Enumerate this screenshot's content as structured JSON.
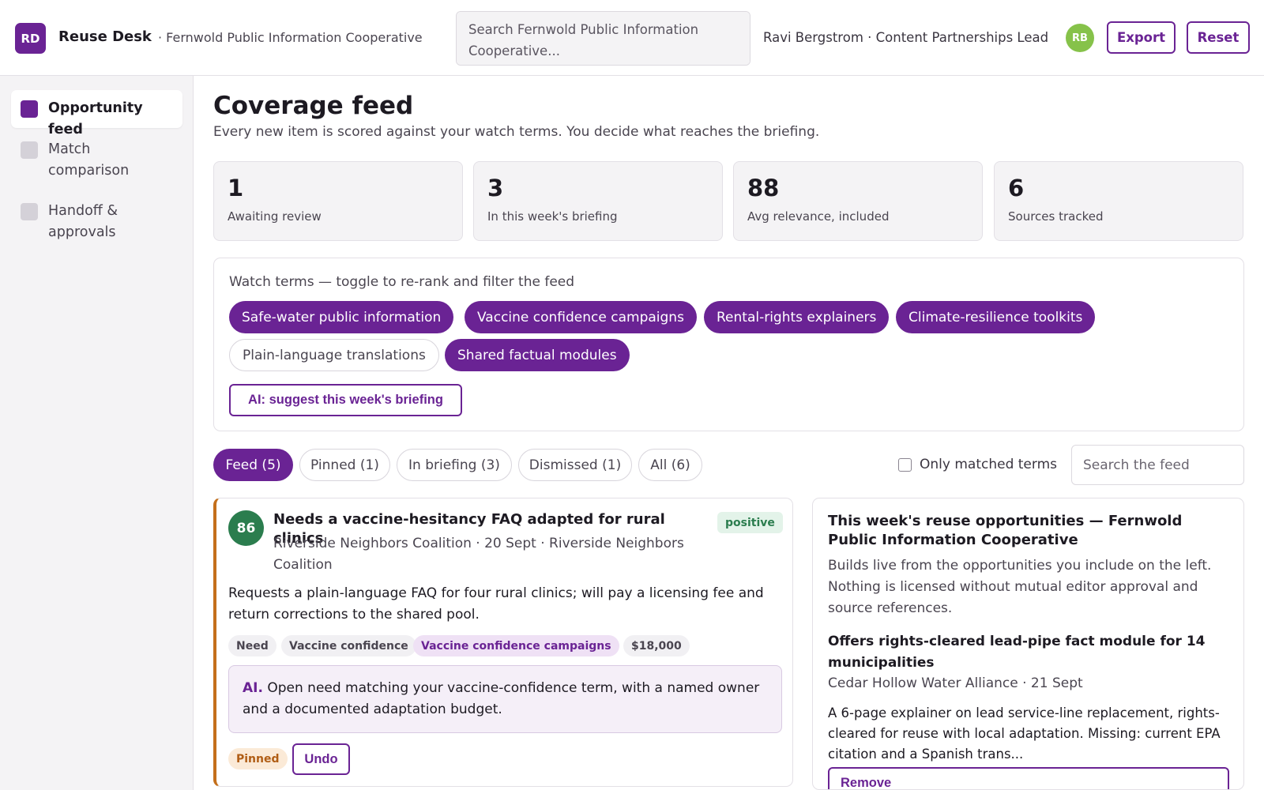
{
  "header": {
    "logo": "RD",
    "app_name": "Reuse Desk",
    "org": "· Fernwold Public Information Cooperative",
    "search_value": "Search Fernwold Public Information Cooperative...",
    "user": "Ravi Bergstrom · Content Partnerships Lead",
    "avatar": "RB",
    "export_label": "Export",
    "reset_label": "Reset"
  },
  "sidebar": {
    "items": [
      {
        "label": "Opportunity feed",
        "active": true
      },
      {
        "label": "Match comparison",
        "active": false
      },
      {
        "label": "Handoff & approvals",
        "active": false
      }
    ]
  },
  "main": {
    "title": "Coverage feed",
    "subtitle": "Every new item is scored against your watch terms. You decide what reaches the briefing."
  },
  "stats": [
    {
      "value": "1",
      "label": "Awaiting review"
    },
    {
      "value": "3",
      "label": "In this week's briefing"
    },
    {
      "value": "88",
      "label": "Avg relevance, included"
    },
    {
      "value": "6",
      "label": "Sources tracked"
    }
  ],
  "watch_terms": {
    "title": "Watch terms — toggle to re-rank and filter the feed",
    "terms": [
      {
        "label": "Safe-water public information",
        "on": true
      },
      {
        "label": "Vaccine confidence campaigns",
        "on": true
      },
      {
        "label": "Rental-rights explainers",
        "on": true
      },
      {
        "label": "Climate-resilience toolkits",
        "on": true
      },
      {
        "label": "Plain-language translations",
        "on": false
      },
      {
        "label": "Shared factual modules",
        "on": true
      }
    ],
    "ai_button": "AI: suggest this week's briefing"
  },
  "tabs": [
    {
      "label": "Feed (5)",
      "active": true
    },
    {
      "label": "Pinned (1)",
      "active": false
    },
    {
      "label": "In briefing (3)",
      "active": false
    },
    {
      "label": "Dismissed (1)",
      "active": false
    },
    {
      "label": "All (6)",
      "active": false
    }
  ],
  "filters": {
    "only_matched_label": "Only matched terms",
    "only_matched_checked": false,
    "search_placeholder": "Search the feed"
  },
  "feed_card": {
    "score": "86",
    "title": "Needs a vaccine-hesitancy FAQ adapted for rural clinics",
    "sentiment": "positive",
    "meta": "Riverside Neighbors Coalition · 20 Sept · Riverside Neighbors Coalition",
    "body": "Requests a plain-language FAQ for four rural clinics; will pay a licensing fee and return corrections to the shared pool.",
    "tags": [
      "Need",
      "Vaccine confidence",
      "Vaccine confidence campaigns",
      "$18,000"
    ],
    "ai_label": "AI.",
    "ai_note": "Open need matching your vaccine-confidence term, with a named owner and a documented adaptation budget.",
    "status": "Pinned",
    "undo_label": "Undo",
    "accent_color": "#c46f1b"
  },
  "briefing": {
    "title": "This week's reuse opportunities — Fernwold Public Information Cooperative",
    "description": "Builds live from the opportunities you include on the left. Nothing is licensed without mutual editor approval and source references.",
    "item": {
      "title": "Offers rights-cleared lead-pipe fact module for 14 municipalities",
      "meta": "Cedar Hollow Water Alliance · 21 Sept",
      "body": "A 6-page explainer on lead service-line replacement, rights-cleared for reuse with local adaptation. Missing: current EPA citation and a Spanish trans...",
      "remove_label": "Remove"
    }
  },
  "colors": {
    "brand": "#6a2394",
    "score_green": "#2b7d4e",
    "avatar_green": "#86c24a"
  }
}
